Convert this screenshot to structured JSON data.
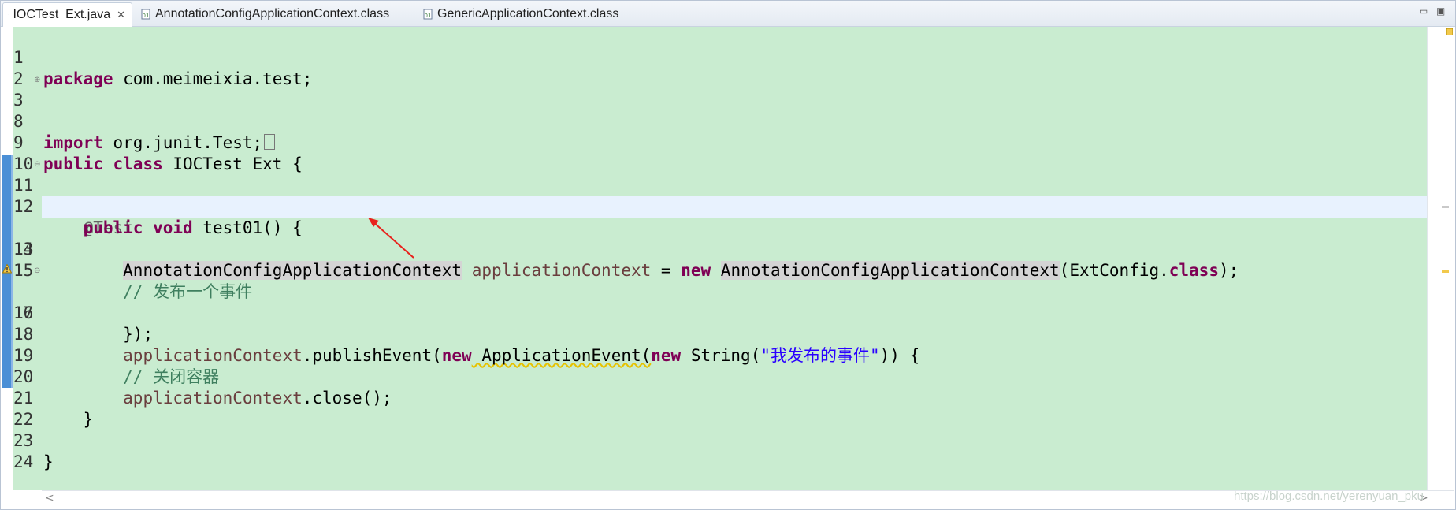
{
  "tabs": [
    {
      "label": "IOCTest_Ext.java",
      "icon": "java-file-icon",
      "active": true,
      "close": "✕"
    },
    {
      "label": "AnnotationConfigApplicationContext.class",
      "icon": "class-file-icon",
      "active": false
    },
    {
      "label": "GenericApplicationContext.class",
      "icon": "class-file-icon",
      "active": false
    }
  ],
  "window_controls": {
    "minimize": "▭",
    "maximize": "▣"
  },
  "editor": {
    "background": "#c9ecd0",
    "current_line": 13,
    "lines": [
      {
        "n": "1"
      },
      {
        "n": "2"
      },
      {
        "n": "3"
      },
      {
        "n": "8"
      },
      {
        "n": "9"
      },
      {
        "n": "10"
      },
      {
        "n": "11"
      },
      {
        "n": "12"
      },
      {
        "n": "13"
      },
      {
        "n": "14"
      },
      {
        "n": "15"
      },
      {
        "n": "16"
      },
      {
        "n": "17"
      },
      {
        "n": "18"
      },
      {
        "n": "19"
      },
      {
        "n": "20"
      },
      {
        "n": "21"
      },
      {
        "n": "22"
      },
      {
        "n": "23"
      },
      {
        "n": "24"
      }
    ],
    "tokens": {
      "l1_kw": "package",
      "l1_rest": " com.meimeixia.test;",
      "l3_kw": "import",
      "l3_rest": " org.junit.Test;",
      "l9_kw1": "public",
      "l9_kw2": "class",
      "l9_rest": " IOCTest_Ext {",
      "l11_ann": "@Test",
      "l12_kw1": "public",
      "l12_kw2": "void",
      "l12_rest": " test01() {",
      "l13_type": "AnnotationConfigApplicationContext",
      "l13_var": "applicationContext",
      "l13_eq": " = ",
      "l13_kw": "new",
      "l13_type2": "AnnotationConfigApplicationContext",
      "l13_args": "(ExtConfig.",
      "l13_kw2": "class",
      "l13_end": ");",
      "l15_cmt": "// 发布一个事件",
      "l16_var": "applicationContext",
      "l16_a": ".publishEvent(",
      "l16_kw": "new",
      "l16_b": " ApplicationEvent(",
      "l16_kw2": "new",
      "l16_c": " String(",
      "l16_str": "\"我发布的事件\"",
      "l16_d": ")) {",
      "l17": "});",
      "l19_cmt": "// 关闭容器",
      "l20_var": "applicationContext",
      "l20_rest": ".close();",
      "l21": "}",
      "l23": "}"
    }
  },
  "watermark": "https://blog.csdn.net/yerenyuan_pku",
  "scroll": {
    "left": "<",
    "right": ">"
  },
  "colors": {
    "keyword": "#7f0055",
    "comment": "#3f7f5f",
    "string": "#2a00ff",
    "annotation": "#646464",
    "local_var": "#6a3e3e",
    "change_bar": "#4a8fd6",
    "arrow": "#e8211c"
  }
}
